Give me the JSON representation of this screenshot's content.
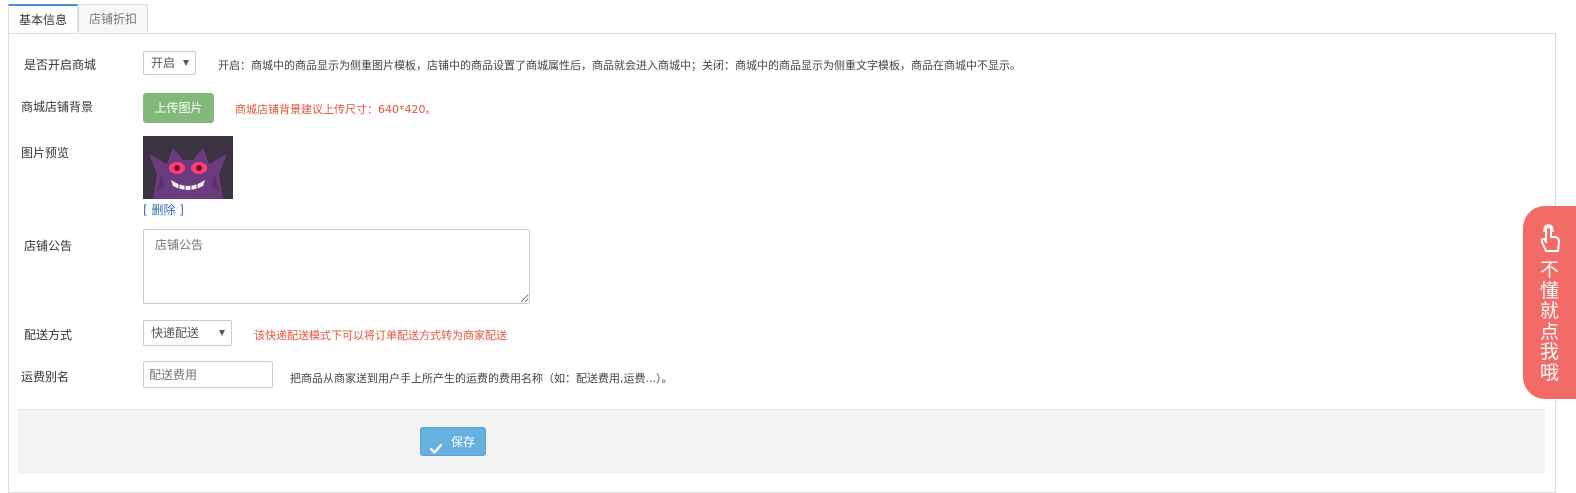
{
  "tabs": [
    {
      "label": "基本信息",
      "active": true
    },
    {
      "label": "店铺折扣",
      "active": false
    }
  ],
  "form": {
    "mall_enable": {
      "label": "是否开启商城",
      "selected": "开启",
      "hint": "开启：商城中的商品显示为侧重图片模板，店铺中的商品设置了商城属性后，商品就会进入商城中；关闭：商城中的商品显示为侧重文字模板，商品在商城中不显示。"
    },
    "background": {
      "label": "商城店铺背景",
      "upload_button": "上传图片",
      "hint": "商城店铺背景建议上传尺寸：640*420。"
    },
    "preview": {
      "label": "图片预览",
      "delete_link": "[ 删除 ]"
    },
    "notice": {
      "label": "店铺公告",
      "placeholder": "店铺公告"
    },
    "delivery": {
      "label": "配送方式",
      "selected": "快递配送",
      "hint": "该快递配送模式下可以将订单配送方式转为商家配送"
    },
    "fee_alias": {
      "label": "运费别名",
      "placeholder": "配送费用",
      "hint": "把商品从商家送到用户手上所产生的运费的费用名称（如：配送费用,运费...）。"
    }
  },
  "footer": {
    "save_label": "保存"
  },
  "help_tab": {
    "text": "不\n懂\n就\n点\n我\n哦"
  },
  "colors": {
    "upload_button": "#82b97a",
    "save_button": "#66b1e0",
    "warning_text": "#e2553b",
    "help_tab": "#f26b66",
    "link": "#2f6fb5"
  }
}
